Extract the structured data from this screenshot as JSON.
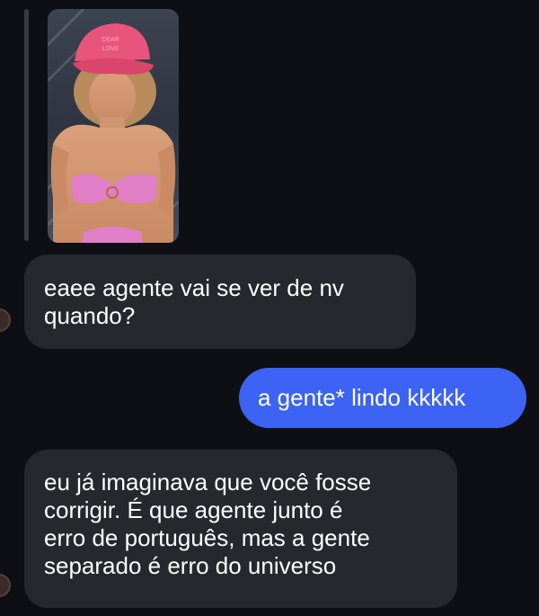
{
  "story_reply": {
    "image_description_icon": "story-photo"
  },
  "messages": [
    {
      "direction": "incoming",
      "lines": [
        "eaee agente vai se ver de nv",
        "quando?"
      ]
    },
    {
      "direction": "outgoing",
      "lines": [
        "a gente* lindo kkkkk"
      ]
    },
    {
      "direction": "incoming",
      "lines": [
        "eu já imaginava que você fosse",
        "corrigir. É que agente junto é",
        "erro de português, mas a gente",
        "separado é erro do universo"
      ]
    }
  ],
  "colors": {
    "background": "#0e0f14",
    "incoming_bubble": "#26282e",
    "outgoing_bubble": "#3c63f3"
  }
}
